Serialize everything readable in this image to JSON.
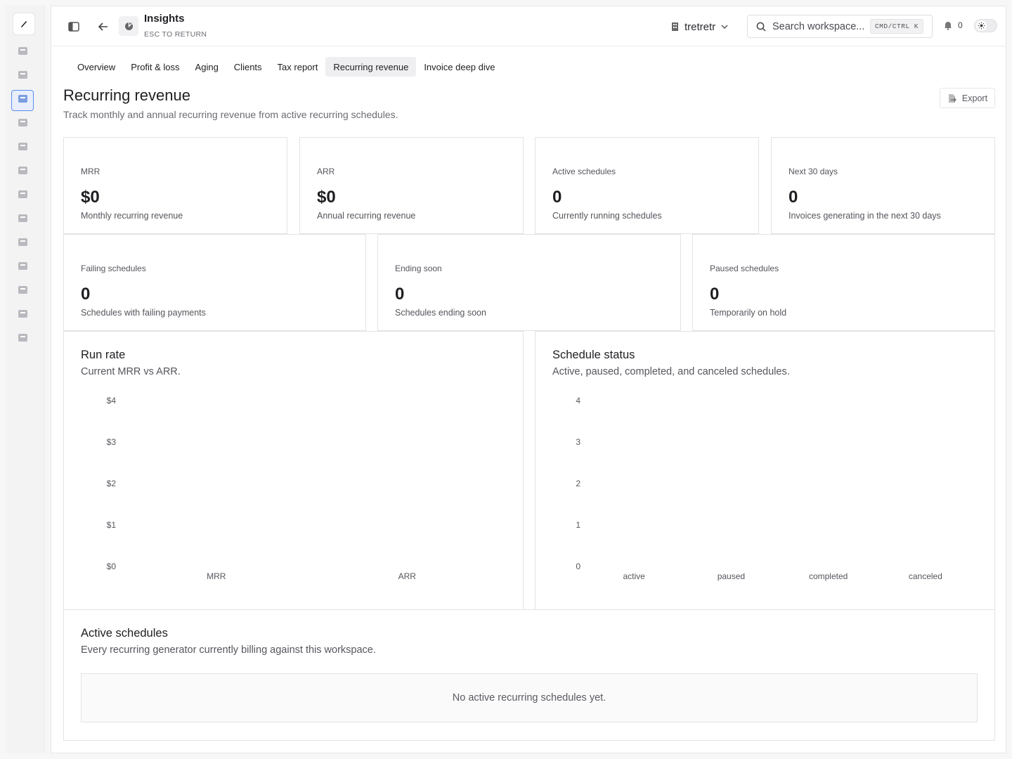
{
  "header": {
    "title": "Insights",
    "subtitle": "ESC TO RETURN",
    "workspace": "tretretr",
    "search_placeholder": "Search workspace...",
    "search_shortcut": "CMD/CTRL K",
    "notification_count": "0"
  },
  "sidebar": {
    "items": [
      "inbox-icon",
      "tools-icon",
      "insights-icon",
      "documents-icon",
      "card-icon",
      "invoice-icon",
      "bell-icon",
      "report-icon",
      "clock-icon",
      "folder-icon",
      "users-icon",
      "archive-icon",
      "alert-icon"
    ],
    "active_index": 2
  },
  "tabs": [
    "Overview",
    "Profit & loss",
    "Aging",
    "Clients",
    "Tax report",
    "Recurring revenue",
    "Invoice deep dive"
  ],
  "active_tab": "Recurring revenue",
  "page": {
    "title": "Recurring revenue",
    "description": "Track monthly and annual recurring revenue from active recurring schedules.",
    "export_label": "Export"
  },
  "kpis": [
    {
      "label": "MRR",
      "value": "$0",
      "sub": "Monthly recurring revenue"
    },
    {
      "label": "ARR",
      "value": "$0",
      "sub": "Annual recurring revenue"
    },
    {
      "label": "Active schedules",
      "value": "0",
      "sub": "Currently running schedules"
    },
    {
      "label": "Next 30 days",
      "value": "0",
      "sub": "Invoices generating in the next 30 days"
    }
  ],
  "kpis2": [
    {
      "label": "Failing schedules",
      "value": "0",
      "sub": "Schedules with failing payments"
    },
    {
      "label": "Ending soon",
      "value": "0",
      "sub": "Schedules ending soon"
    },
    {
      "label": "Paused schedules",
      "value": "0",
      "sub": "Temporarily on hold"
    }
  ],
  "charts": {
    "run_rate": {
      "title": "Run rate",
      "description": "Current MRR vs ARR."
    },
    "status": {
      "title": "Schedule status",
      "description": "Active, paused, completed, and canceled schedules."
    }
  },
  "chart_data": [
    {
      "type": "bar",
      "title": "Run rate",
      "categories": [
        "MRR",
        "ARR"
      ],
      "values": [
        0,
        0
      ],
      "yticks": [
        "$0",
        "$1",
        "$2",
        "$3",
        "$4"
      ],
      "ylim": [
        0,
        4
      ],
      "grid": false
    },
    {
      "type": "bar",
      "title": "Schedule status",
      "categories": [
        "active",
        "paused",
        "completed",
        "canceled"
      ],
      "values": [
        0,
        0,
        0,
        0
      ],
      "yticks": [
        "0",
        "1",
        "2",
        "3",
        "4"
      ],
      "ylim": [
        0,
        4
      ],
      "grid": false
    }
  ],
  "active_schedules": {
    "title": "Active schedules",
    "description": "Every recurring generator currently billing against this workspace.",
    "empty_text": "No active recurring schedules yet."
  }
}
